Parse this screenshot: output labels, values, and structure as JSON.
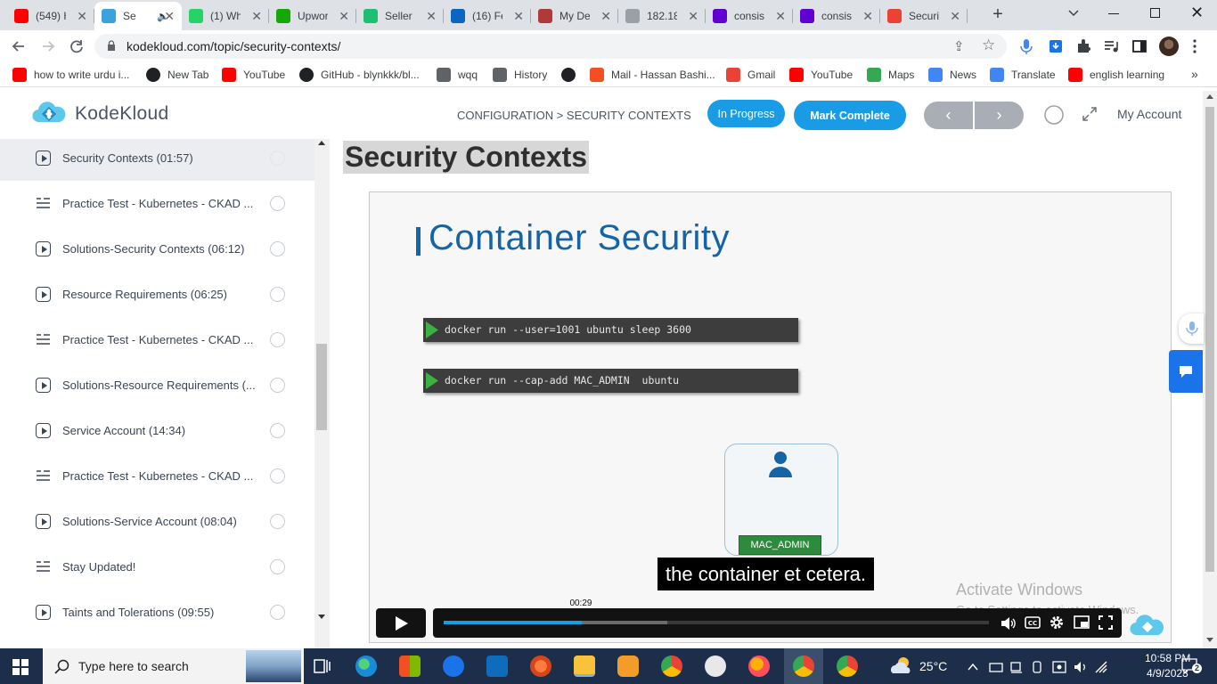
{
  "browser": {
    "tabs": [
      {
        "label": "(549) H",
        "icon": "youtube-icon",
        "color": "#ff0000"
      },
      {
        "label": "Se",
        "icon": "kodekloud-icon",
        "color": "#3aa3db",
        "active": true
      },
      {
        "label": "(1) Wh",
        "icon": "whatsapp-icon",
        "color": "#25d366"
      },
      {
        "label": "Upwor",
        "icon": "upwork-icon",
        "color": "#14a800"
      },
      {
        "label": "Seller",
        "icon": "fiverr-icon",
        "color": "#1dbf73"
      },
      {
        "label": "(16) Fe",
        "icon": "linkedin-icon",
        "color": "#0a66c2"
      },
      {
        "label": "My De",
        "icon": "site-icon",
        "color": "#b03a3a"
      },
      {
        "label": "182.18",
        "icon": "globe-icon",
        "color": "#9aa0a6"
      },
      {
        "label": "consis",
        "icon": "yahoo-icon",
        "color": "#6001d2"
      },
      {
        "label": "consis",
        "icon": "yahoo-icon",
        "color": "#6001d2"
      },
      {
        "label": "Securi",
        "icon": "gmail-icon",
        "color": "#ea4335"
      }
    ],
    "url": "kodekloud.com/topic/security-contexts/",
    "bookmarks": [
      {
        "label": "how to write urdu i...",
        "icon": "youtube-icon",
        "color": "#ff0000"
      },
      {
        "label": "New Tab",
        "icon": "globe-icon",
        "color": "#202124"
      },
      {
        "label": "YouTube",
        "icon": "youtube-icon",
        "color": "#ff0000"
      },
      {
        "label": "GitHub - blynkkk/bl...",
        "icon": "github-icon",
        "color": "#202124"
      },
      {
        "label": "wqq",
        "icon": "download-icon",
        "color": "#5f6368"
      },
      {
        "label": "History",
        "icon": "history-icon",
        "color": "#5f6368"
      },
      {
        "label": "",
        "icon": "globe-icon",
        "color": "#202124"
      },
      {
        "label": "Mail - Hassan Bashi...",
        "icon": "microsoft-icon",
        "color": "#f25022"
      },
      {
        "label": "Gmail",
        "icon": "gmail-icon",
        "color": "#ea4335"
      },
      {
        "label": "YouTube",
        "icon": "youtube-icon",
        "color": "#ff0000"
      },
      {
        "label": "Maps",
        "icon": "maps-icon",
        "color": "#34a853"
      },
      {
        "label": "News",
        "icon": "news-icon",
        "color": "#4285f4"
      },
      {
        "label": "Translate",
        "icon": "translate-icon",
        "color": "#4285f4"
      },
      {
        "label": "english learning",
        "icon": "youtube-icon",
        "color": "#ff0000"
      }
    ]
  },
  "site": {
    "logo_text": "KodeKloud",
    "breadcrumb": "CONFIGURATION > SECURITY CONTEXTS",
    "status_button": "In Progress",
    "complete_button": "Mark Complete",
    "prev": "‹",
    "next": "›",
    "account": "My Account",
    "accent": "#1a9be6"
  },
  "sidebar": {
    "items": [
      {
        "label": "Security Contexts (01:57)",
        "type": "video",
        "active": true
      },
      {
        "label": "Practice Test - Kubernetes - CKAD ...",
        "type": "lab"
      },
      {
        "label": "Solutions-Security Contexts (06:12)",
        "type": "video"
      },
      {
        "label": "Resource Requirements (06:25)",
        "type": "video"
      },
      {
        "label": "Practice Test - Kubernetes - CKAD ...",
        "type": "lab"
      },
      {
        "label": "Solutions-Resource Requirements (...",
        "type": "video"
      },
      {
        "label": "Service Account (14:34)",
        "type": "video"
      },
      {
        "label": "Practice Test - Kubernetes - CKAD ...",
        "type": "lab"
      },
      {
        "label": "Solutions-Service Account (08:04)",
        "type": "video"
      },
      {
        "label": "Stay Updated!",
        "type": "lab"
      },
      {
        "label": "Taints and Tolerations (09:55)",
        "type": "video"
      }
    ]
  },
  "main": {
    "title": "Security Contexts",
    "video": {
      "slide_title": "Container Security",
      "cmd1": "docker run --user=1001 ubuntu sleep 3600",
      "cmd2": "docker run --cap-add MAC_ADMIN  ubuntu",
      "user_badge": "MAC_ADMIN",
      "caption": "the container et cetera.",
      "time_tooltip": "00:29",
      "progress": 0.254,
      "buffered": 0.41,
      "watermark1": "Activate Windows",
      "watermark2": "Go to Settings to activate Windows."
    }
  },
  "taskbar": {
    "search_placeholder": "Type here to search",
    "weather": "25°C",
    "time": "10:58 PM",
    "date": "4/9/2023",
    "notifications": "2"
  }
}
